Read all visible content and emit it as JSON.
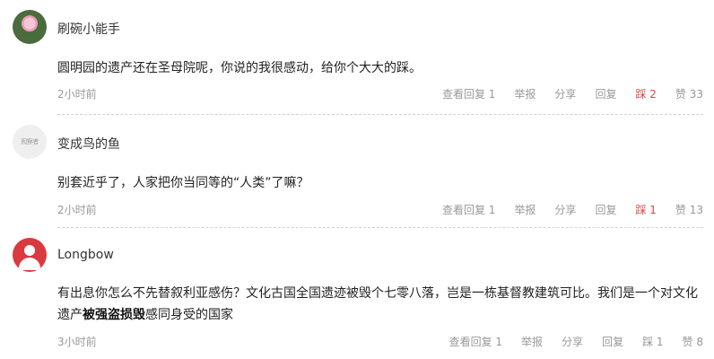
{
  "comments": [
    {
      "username": "刷碗小能手",
      "avatar": "lotus-avatar",
      "content": "圆明园的遗产还在圣母院呢，你说的我很感动，给你个大大的踩。",
      "time": "2小时前",
      "view_replies": "查看回复 1",
      "report": "举报",
      "share": "分享",
      "reply": "回复",
      "downvote": "踩 2",
      "like": "赞 33"
    },
    {
      "username": "变成鸟的鱼",
      "avatar_text": "观察者",
      "content": "别套近乎了，人家把你当同等的“人类”了嘛？",
      "time": "2小时前",
      "view_replies": "查看回复 1",
      "report": "举报",
      "share": "分享",
      "reply": "回复",
      "downvote": "踩 1",
      "like": "赞 13"
    },
    {
      "username": "Longbow",
      "avatar": "default-user-avatar",
      "content_part1": "有出息你怎么不先替叙利亚感伤？文化古国全国遗迹被毁个七零八落，岂是一栋基督教建筑可比。我们是一个对文化遗产",
      "content_bold": "被强盗损毁",
      "content_part2": "感同身受的国家",
      "time": "3小时前",
      "view_replies": "查看回复 1",
      "report": "举报",
      "share": "分享",
      "reply": "回复",
      "downvote": "踩 1",
      "like": "赞 8"
    }
  ],
  "colors": {
    "downvote_active": "#d44b4b",
    "meta": "#999999",
    "avatar_red": "#d93a3f"
  }
}
